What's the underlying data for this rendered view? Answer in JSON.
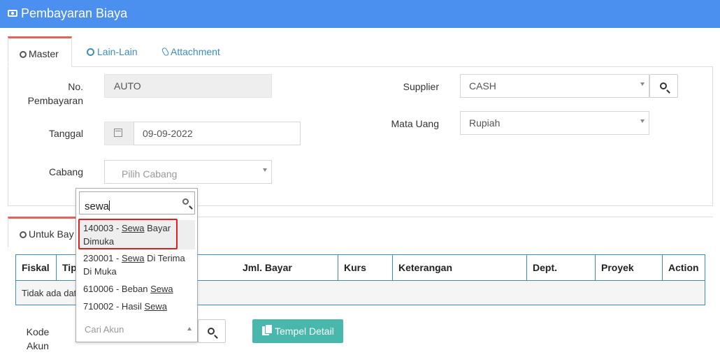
{
  "header": {
    "title": "Pembayaran Biaya"
  },
  "tabs": [
    {
      "label": "Master"
    },
    {
      "label": "Lain-Lain"
    },
    {
      "label": "Attachment"
    }
  ],
  "form": {
    "no_pembayaran": {
      "label_line1": "No.",
      "label_line2": "Pembayaran",
      "value": "AUTO"
    },
    "tanggal": {
      "label": "Tanggal",
      "value": "09-09-2022"
    },
    "cabang": {
      "label": "Cabang",
      "placeholder": "Pilih Cabang"
    },
    "supplier": {
      "label": "Supplier",
      "value": "CASH"
    },
    "mata_uang": {
      "label": "Mata Uang",
      "value": "Rupiah"
    }
  },
  "detail": {
    "tab_label": "Untuk Bay",
    "columns": [
      "Fiskal",
      "Tip",
      "Jml. Bayar",
      "Kurs",
      "Keterangan",
      "Dept.",
      "Proyek",
      "Action"
    ],
    "empty_text": "Tidak ada dat",
    "kode_akun_line1": "Kode",
    "kode_akun_line2": "Akun",
    "paste_button": "Tempel Detail"
  },
  "dropdown": {
    "search_value": "sewa",
    "options": [
      {
        "pre": "140003 - ",
        "match": "Sewa",
        "post_line1": " Bayar",
        "line2": "Dimuka"
      },
      {
        "pre": "230001 - ",
        "match": "Sewa",
        "post_line1": " Di Terima",
        "line2": "Di Muka"
      },
      {
        "pre": "610006 - Beban ",
        "match": "Sewa",
        "post_line1": "",
        "line2": ""
      },
      {
        "pre": "710002 - Hasil ",
        "match": "Sewa",
        "post_line1": "",
        "line2": ""
      }
    ],
    "footer_placeholder": "Cari Akun"
  },
  "colors": {
    "header": "#4b90ef",
    "accent_tab": "#e0645f",
    "link": "#3c8dbc",
    "button_green": "#47b8ab",
    "highlight": "#e02020"
  }
}
